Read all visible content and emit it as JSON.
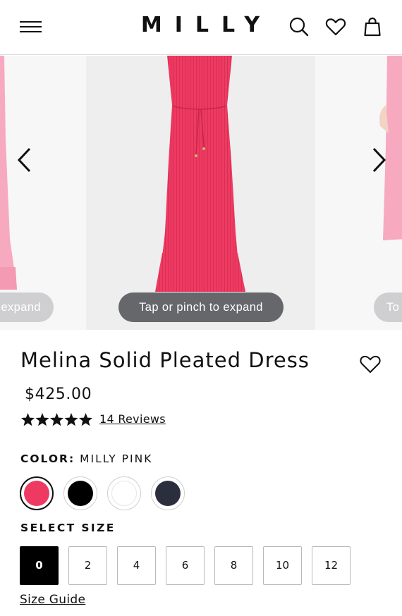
{
  "header": {
    "logo": "MILLY",
    "icons": [
      "menu-icon",
      "search-icon",
      "heart-icon",
      "bag-icon"
    ]
  },
  "carousel": {
    "hint_center": "Tap or pinch to expand",
    "hint_left": "expand",
    "hint_right": "To",
    "product_color": "#ee3a62"
  },
  "product": {
    "title": "Melina Solid Pleated Dress",
    "price": "$425.00",
    "rating": 5,
    "reviews": "14 Reviews"
  },
  "color": {
    "label": "COLOR:",
    "value": "MILLY PINK",
    "swatches": [
      {
        "name": "pink",
        "hex": "#ee3a62",
        "selected": true
      },
      {
        "name": "black",
        "hex": "#000000",
        "selected": false
      },
      {
        "name": "white",
        "hex": "#ffffff",
        "selected": false
      },
      {
        "name": "navy",
        "hex": "#2b2e3d",
        "selected": false
      }
    ]
  },
  "size": {
    "label": "SELECT SIZE",
    "options": [
      "0",
      "2",
      "4",
      "6",
      "8",
      "10",
      "12"
    ],
    "selected": "0",
    "guide": "Size Guide"
  }
}
